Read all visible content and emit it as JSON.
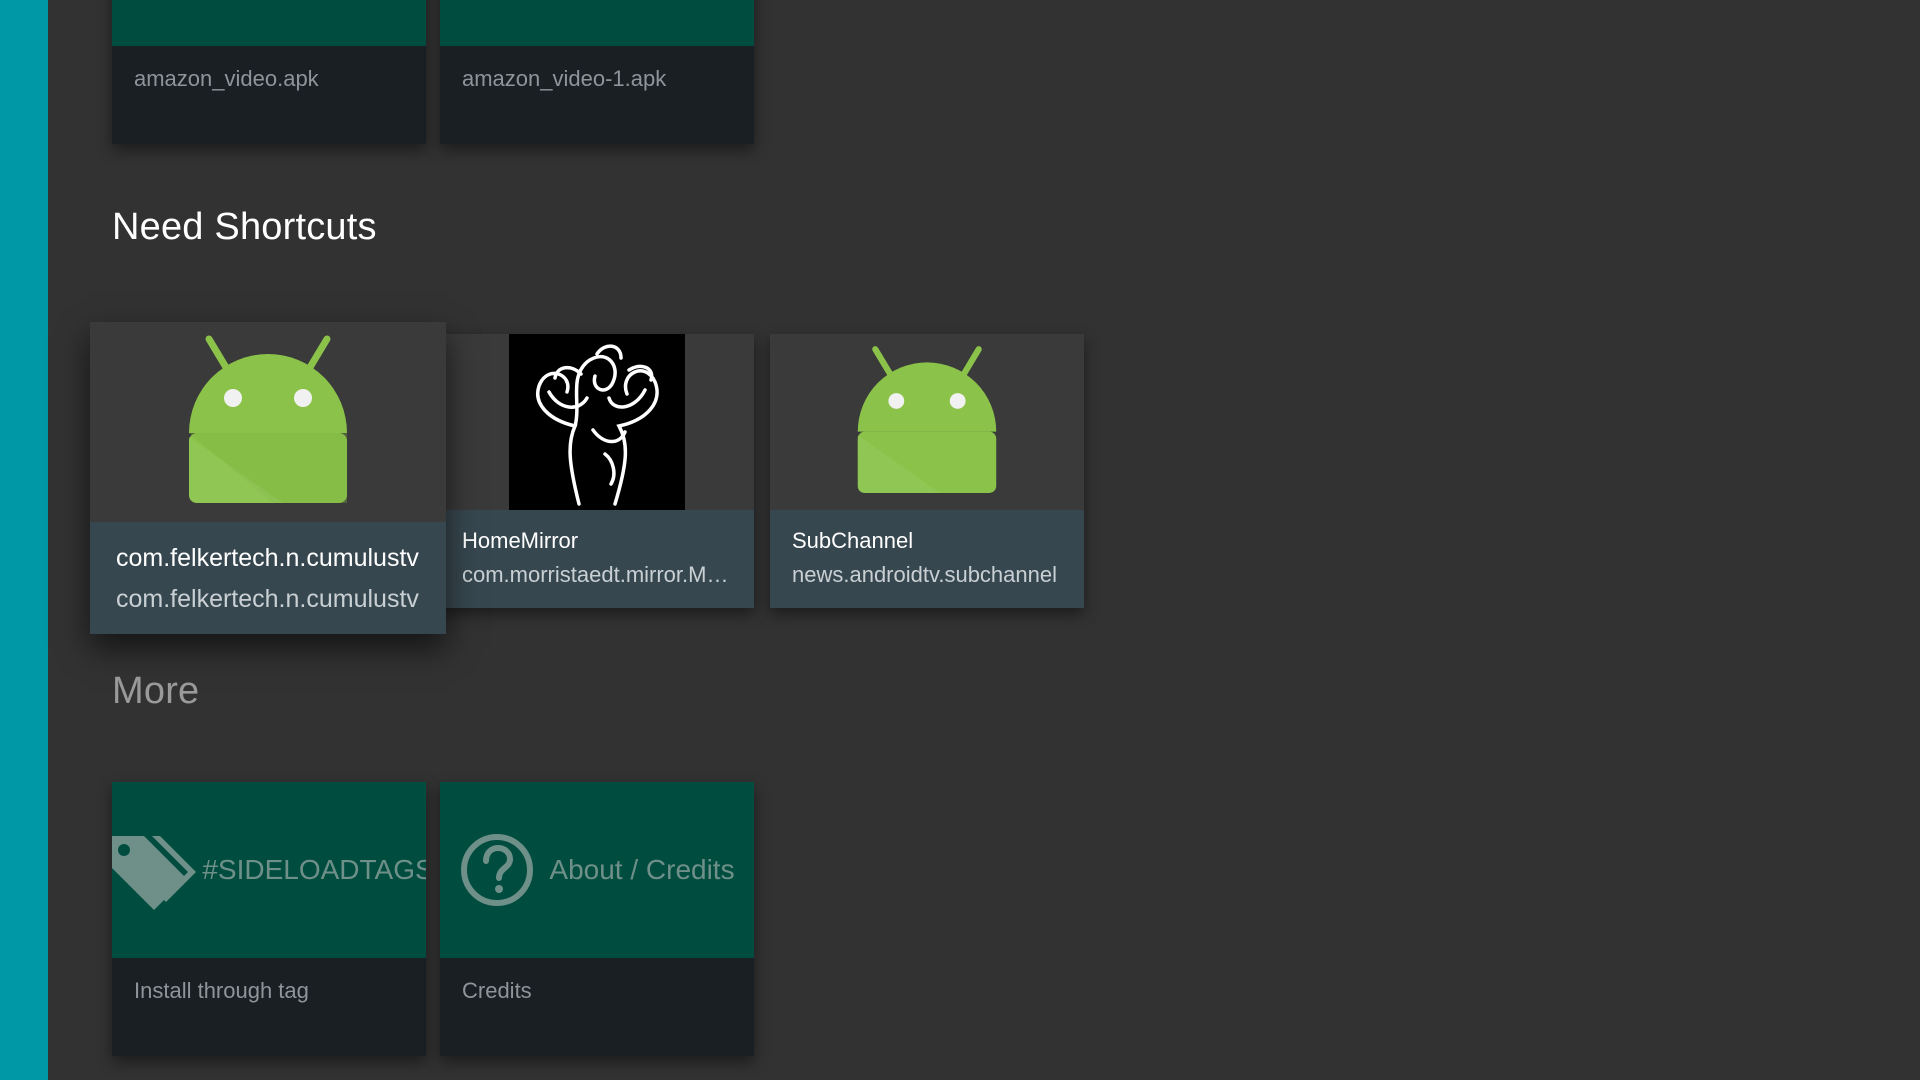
{
  "colors": {
    "background": "#323232",
    "side_rail": "#0097a7",
    "tile_teal": "#004d40",
    "info_slate": "#37474f",
    "info_dark": "#1a1f24",
    "android_green": "#8bc34a"
  },
  "apk_row": {
    "items": [
      {
        "filename": "amazon_video.apk"
      },
      {
        "filename": "amazon_video-1.apk"
      }
    ]
  },
  "need_shortcuts": {
    "title": "Need Shortcuts",
    "items": [
      {
        "title": "com.felkertech.n.cumulustv",
        "subtitle": "com.felkertech.n.cumulustv",
        "icon": "android-robot-icon"
      },
      {
        "title": "HomeMirror",
        "subtitle": "com.morristaedt.mirror.MirrorActivity",
        "icon": "homemirror-icon"
      },
      {
        "title": "SubChannel",
        "subtitle": "news.androidtv.subchannel",
        "icon": "android-robot-icon"
      }
    ]
  },
  "more": {
    "title": "More",
    "items": [
      {
        "tile_label": "#SIDELOADTAGS",
        "description": "Install through tag",
        "icon": "tag-icon"
      },
      {
        "tile_label": "About / Credits",
        "description": "Credits",
        "icon": "help-circle-icon"
      }
    ]
  }
}
